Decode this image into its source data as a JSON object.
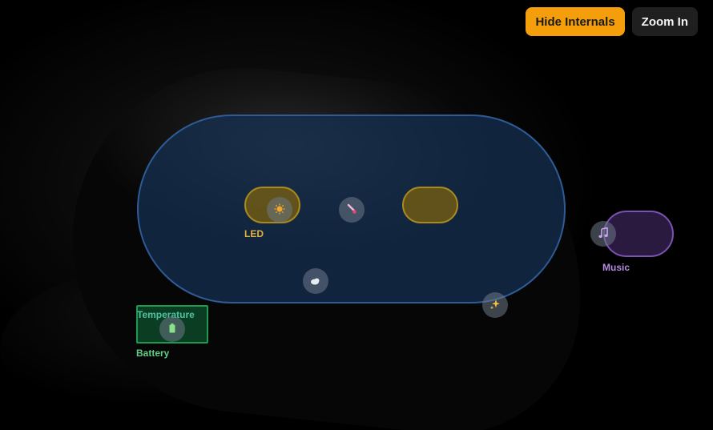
{
  "toolbar": {
    "hide_internals_label": "Hide Internals",
    "zoom_in_label": "Zoom In"
  },
  "components": {
    "led": {
      "label": "LED",
      "color": "#e2b23a",
      "icon": "sun-icon"
    },
    "temperature": {
      "icon": "thermometer-icon"
    },
    "battery": {
      "label": "Battery",
      "overlay_label": "Temperature",
      "color": "#5fcf86",
      "icon": "battery-icon"
    },
    "music": {
      "label": "Music",
      "color": "#b48be0",
      "icon": "music-note-icon"
    },
    "cloud": {
      "icon": "cloud-icon"
    },
    "sparkle": {
      "icon": "sparkle-icon"
    }
  },
  "colors": {
    "accent": "#f59e0b",
    "internals_fill": "#163054",
    "internals_border": "#2d5c97"
  }
}
